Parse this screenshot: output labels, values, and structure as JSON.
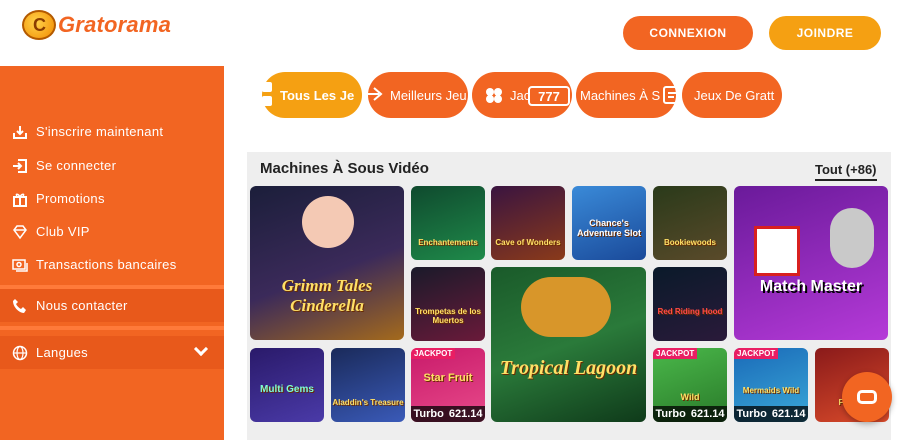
{
  "header": {
    "logo_text": "Gratorama",
    "login_label": "CONNEXION",
    "join_label": "JOINDRE"
  },
  "sidebar": {
    "items": [
      {
        "label": "S'inscrire maintenant",
        "icon": "download-icon"
      },
      {
        "label": "Se connecter",
        "icon": "login-icon"
      },
      {
        "label": "Promotions",
        "icon": "gift-icon"
      },
      {
        "label": "Club VIP",
        "icon": "diamond-icon"
      },
      {
        "label": "Transactions bancaires",
        "icon": "money-icon"
      },
      {
        "label": "Nous contacter",
        "icon": "phone-icon"
      },
      {
        "label": "Langues",
        "icon": "globe-icon"
      }
    ]
  },
  "categories": [
    {
      "label": "Tous Les Je",
      "active": true
    },
    {
      "label": "Meilleurs Jeu"
    },
    {
      "label": "Jac"
    },
    {
      "label": "Machines À S"
    },
    {
      "label": "Jeux De Gratt"
    }
  ],
  "section": {
    "title": "Machines À Sous Vidéo",
    "all_label": "Tout (+86)"
  },
  "games": [
    {
      "name": "Grimm Tales Cinderella"
    },
    {
      "name": "Enchantements"
    },
    {
      "name": "Cave of Wonders"
    },
    {
      "name": "Chance's Adventure Slot"
    },
    {
      "name": "Bookiewoods"
    },
    {
      "name": "Match Master"
    },
    {
      "name": "Trompetas de los Muertos"
    },
    {
      "name": "Tropical Lagoon"
    },
    {
      "name": "Red Riding Hood"
    },
    {
      "name": "Multi Gems"
    },
    {
      "name": "Aladdin's Treasure"
    },
    {
      "name": "Star Fruit",
      "badge": "JACKPOT",
      "turbo": "Turbo",
      "value": "621.14"
    },
    {
      "name": "Wild",
      "badge": "JACKPOT",
      "turbo": "Turbo",
      "value": "621.14"
    },
    {
      "name": "Mermaids Wild",
      "badge": "JACKPOT",
      "turbo": "Turbo",
      "value": "621.14"
    },
    {
      "name": "Fighter"
    }
  ],
  "colors": {
    "brand": "#f26522",
    "accent": "#f5a012"
  }
}
